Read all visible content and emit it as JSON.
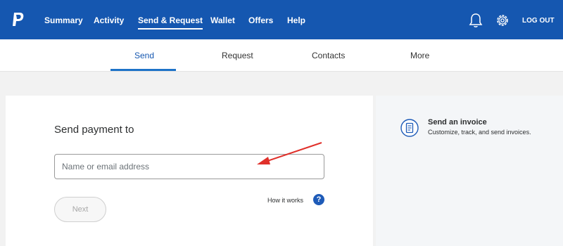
{
  "header": {
    "logo_icon": "paypal-logo",
    "nav": [
      {
        "label": "Summary",
        "active": false
      },
      {
        "label": "Activity",
        "active": false
      },
      {
        "label": "Send & Request",
        "active": true
      },
      {
        "label": "Wallet",
        "active": false
      },
      {
        "label": "Offers",
        "active": false
      },
      {
        "label": "Help",
        "active": false
      }
    ],
    "notifications_icon": "bell-icon",
    "settings_icon": "gear-icon",
    "logout_label": "LOG OUT",
    "brand_color": "#1557b0"
  },
  "subnav": {
    "tabs": [
      {
        "label": "Send",
        "active": true
      },
      {
        "label": "Request",
        "active": false
      },
      {
        "label": "Contacts",
        "active": false
      },
      {
        "label": "More",
        "active": false
      }
    ],
    "active_color": "#1e73c8"
  },
  "send_form": {
    "heading": "Send payment to",
    "recipient_placeholder": "Name or email address",
    "recipient_value": "",
    "next_label": "Next",
    "how_it_works_label": "How it works",
    "help_icon": "question-circle-icon"
  },
  "invoice_panel": {
    "icon": "invoice-icon",
    "title": "Send an invoice",
    "description": "Customize, track, and send invoices."
  },
  "annotation": {
    "type": "arrow",
    "color": "#e0302a"
  }
}
